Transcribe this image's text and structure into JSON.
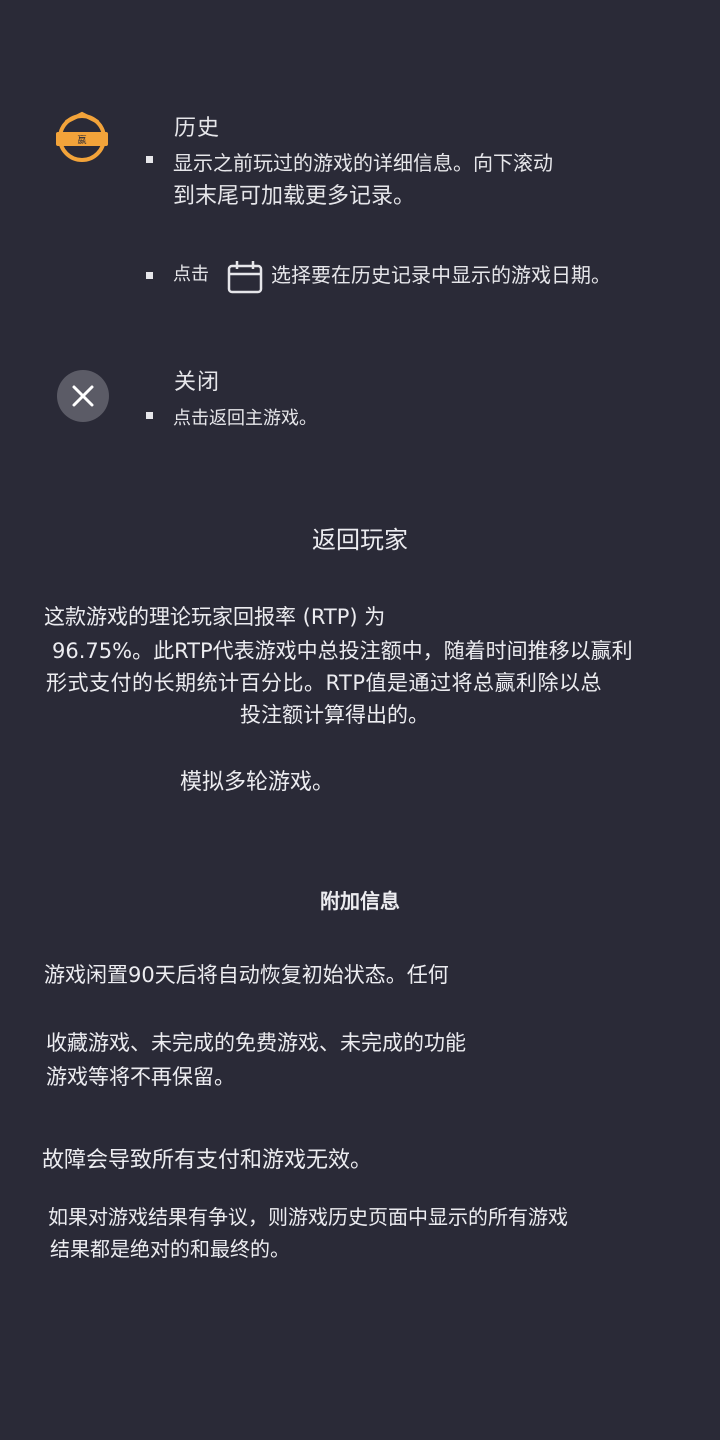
{
  "history": {
    "title": "历史",
    "badge_text": "嬴",
    "bullet1_line1": "显示之前玩过的游戏的详细信息。向下滚动",
    "bullet1_line2": "到末尾可加载更多记录。",
    "bullet2_prefix": "点击",
    "bullet2_suffix": "选择要在历史记录中显示的游戏日期。",
    "icon": "trophy-badge-icon",
    "accent_color": "#f2a33a"
  },
  "close": {
    "title": "关闭",
    "bullet": "点击返回主游戏。",
    "icon": "close-icon"
  },
  "rtp": {
    "heading": "返回玩家",
    "line1": "这款游戏的理论玩家回报率 (RTP) 为",
    "line2": "96.75%。此RTP代表游戏中总投注额中，随着时间推移以赢利",
    "line3": "形式支付的长期统计百分比。RTP值是通过将总赢利除以总",
    "line4": "投注额计算得出的。",
    "line5": "模拟多轮游戏。"
  },
  "extra": {
    "heading": "附加信息",
    "p1": "游戏闲置90天后将自动恢复初始状态。任何",
    "p2_line1": "收藏游戏、未完成的免费游戏、未完成的功能",
    "p2_line2": "游戏等将不再保留。",
    "p3": "故障会导致所有支付和游戏无效。",
    "p4_line1": "如果对游戏结果有争议，则游戏历史页面中显示的所有游戏",
    "p4_line2": "结果都是绝对的和最终的。"
  }
}
